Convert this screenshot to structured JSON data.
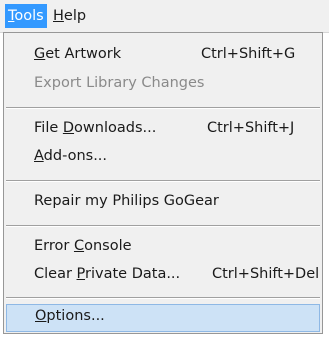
{
  "menubar": {
    "tools": {
      "prefix": "",
      "accel": "T",
      "rest": "ools"
    },
    "help": {
      "prefix": "",
      "accel": "H",
      "rest": "elp"
    }
  },
  "menu": {
    "get_artwork": {
      "prefix": "",
      "accel": "G",
      "rest": "et Artwork",
      "shortcut": "Ctrl+Shift+G"
    },
    "export_library": {
      "label": "Export Library Changes"
    },
    "file_downloads": {
      "prefix": "File ",
      "accel": "D",
      "rest": "ownloads...",
      "shortcut": "Ctrl+Shift+J"
    },
    "addons": {
      "prefix": "",
      "accel": "A",
      "rest": "dd-ons..."
    },
    "repair": {
      "label": "Repair my Philips GoGear"
    },
    "error_console": {
      "prefix": "Error ",
      "accel": "C",
      "rest": "onsole"
    },
    "clear_private": {
      "prefix": "Clear ",
      "accel": "P",
      "rest": "rivate Data...",
      "shortcut": "Ctrl+Shift+Del"
    },
    "options": {
      "prefix": "",
      "accel": "O",
      "rest": "ptions..."
    }
  }
}
